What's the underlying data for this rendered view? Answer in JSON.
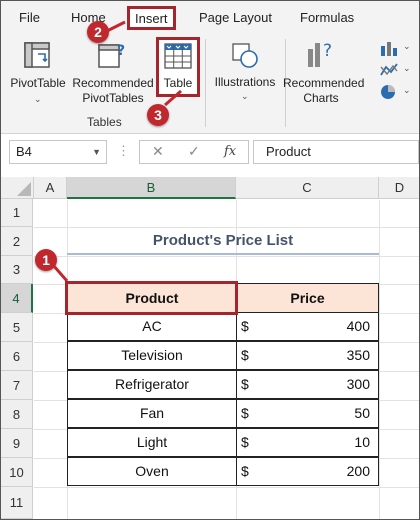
{
  "tabs": {
    "file": "File",
    "home": "Home",
    "insert": "Insert",
    "page_layout": "Page Layout",
    "formulas": "Formulas"
  },
  "ribbon": {
    "pivot_table": "PivotTable",
    "recommended_pivot_line1": "Recommended",
    "recommended_pivot_line2": "PivotTables",
    "table": "Table",
    "tables_group": "Tables",
    "illustrations": "Illustrations",
    "recommended_charts_line1": "Recommended",
    "recommended_charts_line2": "Charts"
  },
  "formula_bar": {
    "name_box": "B4",
    "fx": "fx",
    "value": "Product",
    "cancel": "✕",
    "enter": "✓"
  },
  "grid": {
    "columns": [
      "A",
      "B",
      "C",
      "D"
    ],
    "rows": [
      "1",
      "2",
      "3",
      "4",
      "5",
      "6",
      "7",
      "8",
      "9",
      "10",
      "11"
    ]
  },
  "sheet": {
    "title": "Product's Price List",
    "headers": {
      "product": "Product",
      "price": "Price"
    },
    "currency": "$",
    "rows": [
      {
        "product": "AC",
        "price": "400"
      },
      {
        "product": "Television",
        "price": "350"
      },
      {
        "product": "Refrigerator",
        "price": "300"
      },
      {
        "product": "Fan",
        "price": "50"
      },
      {
        "product": "Light",
        "price": "10"
      },
      {
        "product": "Oven",
        "price": "200"
      }
    ]
  },
  "steps": {
    "one": "1",
    "two": "2",
    "three": "3"
  },
  "colors": {
    "accent_red": "#a4262c",
    "badge_red": "#c0282e",
    "header_fill": "#fce4d6",
    "excel_green": "#217346",
    "title_color": "#44546a"
  }
}
